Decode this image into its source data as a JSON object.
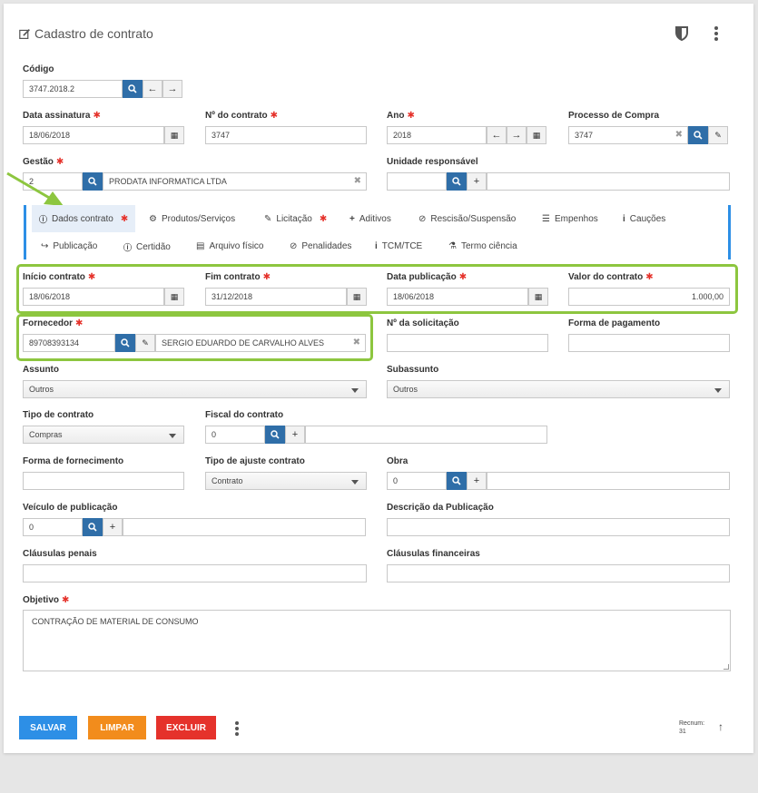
{
  "title": "Cadastro de contrato",
  "fields": {
    "codigo": {
      "label": "Código",
      "value": "3747.2018.2"
    },
    "data_assinatura": {
      "label": "Data assinatura",
      "value": "18/06/2018"
    },
    "numero_contrato": {
      "label": "Nº do contrato",
      "value": "3747"
    },
    "ano": {
      "label": "Ano",
      "value": "2018"
    },
    "processo_compra": {
      "label": "Processo de Compra",
      "value": "3747"
    },
    "gestao": {
      "label": "Gestão",
      "value": "2",
      "name": "PRODATA INFORMATICA LTDA"
    },
    "unidade_responsavel": {
      "label": "Unidade responsável",
      "value": ""
    },
    "inicio_contrato": {
      "label": "Início contrato",
      "value": "18/06/2018"
    },
    "fim_contrato": {
      "label": "Fim contrato",
      "value": "31/12/2018"
    },
    "data_publicacao": {
      "label": "Data publicação",
      "value": "18/06/2018"
    },
    "valor_contrato": {
      "label": "Valor do contrato",
      "value": "1.000,00"
    },
    "fornecedor": {
      "label": "Fornecedor",
      "value": "89708393134",
      "name": "SERGIO EDUARDO DE CARVALHO ALVES"
    },
    "numero_solicitacao": {
      "label": "Nº da solicitação",
      "value": ""
    },
    "forma_pagamento": {
      "label": "Forma de pagamento",
      "value": ""
    },
    "assunto": {
      "label": "Assunto",
      "value": "Outros"
    },
    "subassunto": {
      "label": "Subassunto",
      "value": "Outros"
    },
    "tipo_contrato": {
      "label": "Tipo de contrato",
      "value": "Compras"
    },
    "fiscal_contrato": {
      "label": "Fiscal do contrato",
      "value": "0"
    },
    "forma_fornecimento": {
      "label": "Forma de fornecimento",
      "value": ""
    },
    "tipo_ajuste": {
      "label": "Tipo de ajuste contrato",
      "value": "Contrato"
    },
    "obra": {
      "label": "Obra",
      "value": "0"
    },
    "veiculo_publicacao": {
      "label": "Veículo de publicação",
      "value": "0"
    },
    "descricao_publicacao": {
      "label": "Descrição da Publicação",
      "value": ""
    },
    "clausulas_penais": {
      "label": "Cláusulas penais",
      "value": ""
    },
    "clausulas_financeiras": {
      "label": "Cláusulas financeiras",
      "value": ""
    },
    "objetivo": {
      "label": "Objetivo",
      "value": "CONTRAÇÃO DE MATERIAL DE CONSUMO"
    }
  },
  "tabs": {
    "dados": "Dados contrato",
    "produtos": "Produtos/Serviços",
    "licitacao": "Licitação",
    "aditivos": "Aditivos",
    "rescisao": "Rescisão/Suspensão",
    "empenhos": "Empenhos",
    "caucoes": "Cauções",
    "publicacao": "Publicação",
    "certidao": "Certidão",
    "arquivo": "Arquivo físico",
    "penalidades": "Penalidades",
    "tcm": "TCM/TCE",
    "termo": "Termo ciência"
  },
  "actions": {
    "salvar": "SALVAR",
    "limpar": "LIMPAR",
    "excluir": "EXCLUIR"
  },
  "recnum": {
    "label": "Recnum:",
    "value": "31"
  },
  "required_mark": "✱",
  "colors": {
    "primary": "#2f6ea8",
    "salvar": "#2d8fe6",
    "limpar": "#f28c1c",
    "excluir": "#e5322b",
    "highlight": "#8dc63f",
    "required": "#e5322b"
  }
}
